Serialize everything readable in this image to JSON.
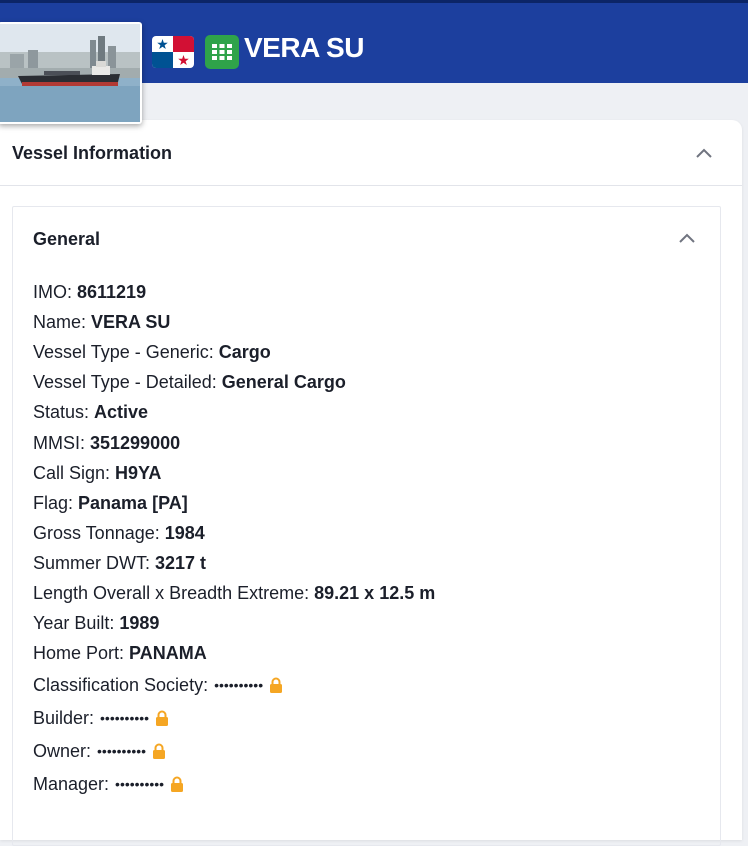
{
  "header": {
    "vessel_name": "VERA SU",
    "flag_icon": "panama-flag-icon",
    "fleet_icon": "grid-icon",
    "colors": {
      "header_bg": "#1c3f9e",
      "fleet_icon_bg": "#2fa34a",
      "lock": "#f5a623"
    }
  },
  "panel": {
    "title": "Vessel Information",
    "section": {
      "title": "General",
      "fields": [
        {
          "label": "IMO:",
          "value": "8611219"
        },
        {
          "label": "Name:",
          "value": "VERA SU"
        },
        {
          "label": "Vessel Type - Generic:",
          "value": "Cargo"
        },
        {
          "label": "Vessel Type - Detailed:",
          "value": "General Cargo"
        },
        {
          "label": "Status:",
          "value": "Active"
        },
        {
          "label": "MMSI:",
          "value": "351299000"
        },
        {
          "label": "Call Sign:",
          "value": "H9YA"
        },
        {
          "label": "Flag:",
          "value": "Panama [PA]"
        },
        {
          "label": "Gross Tonnage:",
          "value": "1984"
        },
        {
          "label": "Summer DWT:",
          "value": "3217 t"
        },
        {
          "label": "Length Overall x Breadth Extreme:",
          "value": "89.21 x 12.5 m"
        },
        {
          "label": "Year Built:",
          "value": "1989"
        },
        {
          "label": "Home Port:",
          "value": "PANAMA"
        }
      ],
      "locked_fields": [
        {
          "label": "Classification Society:",
          "masked": "••••••••••"
        },
        {
          "label": "Builder:",
          "masked": "••••••••••"
        },
        {
          "label": "Owner:",
          "masked": "••••••••••"
        },
        {
          "label": "Manager:",
          "masked": "••••••••••"
        }
      ]
    }
  }
}
